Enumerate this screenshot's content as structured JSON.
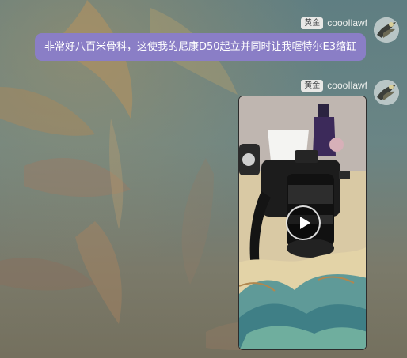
{
  "messages": [
    {
      "badge": "黄金",
      "username": "coooIlawf",
      "text": "非常好八百米骨科，这使我的尼康D50起立并同时让我喔特尔E3缩缸"
    },
    {
      "badge": "黄金",
      "username": "coooIlawf",
      "attachment": {
        "type": "video",
        "play_icon": "play-icon"
      }
    }
  ],
  "colors": {
    "bubble": "#8a7ec6",
    "badge_bg": "#e8e8e6"
  }
}
